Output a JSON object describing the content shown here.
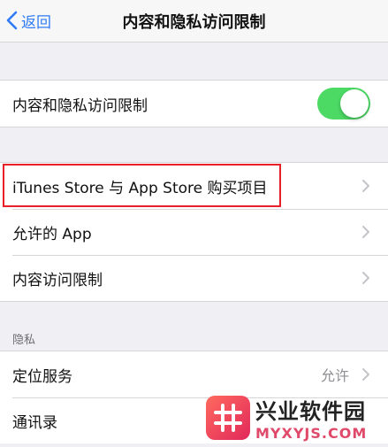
{
  "navbar": {
    "back_label": "返回",
    "title": "内容和隐私访问限制"
  },
  "group1": {
    "toggle_row": {
      "label": "内容和隐私访问限制",
      "toggle_on": true
    }
  },
  "group2": {
    "items": [
      {
        "label": "iTunes Store 与 App Store 购买项目"
      },
      {
        "label": "允许的 App"
      },
      {
        "label": "内容访问限制"
      }
    ]
  },
  "privacy": {
    "header": "隐私",
    "items": [
      {
        "label": "定位服务",
        "value": "允许"
      },
      {
        "label": "通讯录"
      }
    ]
  },
  "watermark": {
    "name": "兴业软件园",
    "url": "MYXYJS.COM"
  },
  "colors": {
    "accent": "#2f7cf6",
    "toggle_on": "#4cd964",
    "highlight": "#e8202a"
  }
}
